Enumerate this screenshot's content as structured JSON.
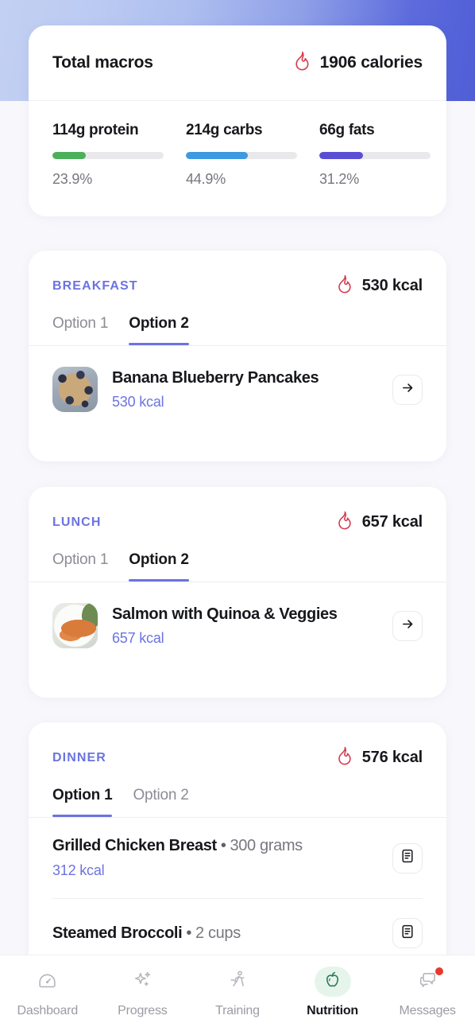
{
  "macros_card": {
    "title": "Total macros",
    "calories_icon": "flame-icon",
    "calories": "1906 calories",
    "items": [
      {
        "label": "114g protein",
        "percent": "23.9%",
        "fill": 30,
        "color": "#4caf5a"
      },
      {
        "label": "214g carbs",
        "percent": "44.9%",
        "fill": 56,
        "color": "#3d9ae0"
      },
      {
        "label": "66g fats",
        "percent": "31.2%",
        "fill": 39,
        "color": "#5a4fd4"
      }
    ]
  },
  "meals": [
    {
      "name": "BREAKFAST",
      "kcal": "530 kcal",
      "tabs": [
        {
          "label": "Option 1",
          "active": false
        },
        {
          "label": "Option 2",
          "active": true
        }
      ],
      "item": {
        "title": "Banana Blueberry Pancakes",
        "kcal": "530 kcal",
        "action_icon": "arrow-right-icon"
      }
    },
    {
      "name": "LUNCH",
      "kcal": "657 kcal",
      "tabs": [
        {
          "label": "Option 1",
          "active": false
        },
        {
          "label": "Option 2",
          "active": true
        }
      ],
      "item": {
        "title": "Salmon with Quinoa & Veggies",
        "kcal": "657 kcal",
        "action_icon": "arrow-right-icon"
      }
    }
  ],
  "dinner": {
    "name": "DINNER",
    "kcal": "576 kcal",
    "tabs": [
      {
        "label": "Option 1",
        "active": true
      },
      {
        "label": "Option 2",
        "active": false
      }
    ],
    "ingredients": [
      {
        "name": "Grilled Chicken Breast",
        "separator": "•",
        "quantity": "300 grams",
        "kcal": "312 kcal",
        "action_icon": "document-icon"
      },
      {
        "name": "Steamed Broccoli",
        "separator": "•",
        "quantity": "2 cups",
        "kcal": "",
        "action_icon": "document-icon"
      }
    ]
  },
  "bottom_nav": {
    "items": [
      {
        "label": "Dashboard",
        "icon": "gauge-icon",
        "active": false,
        "badge": false
      },
      {
        "label": "Progress",
        "icon": "sparkles-icon",
        "active": false,
        "badge": false
      },
      {
        "label": "Training",
        "icon": "runner-icon",
        "active": false,
        "badge": false
      },
      {
        "label": "Nutrition",
        "icon": "apple-icon",
        "active": true,
        "badge": false
      },
      {
        "label": "Messages",
        "icon": "chat-icon",
        "active": false,
        "badge": true
      }
    ]
  }
}
